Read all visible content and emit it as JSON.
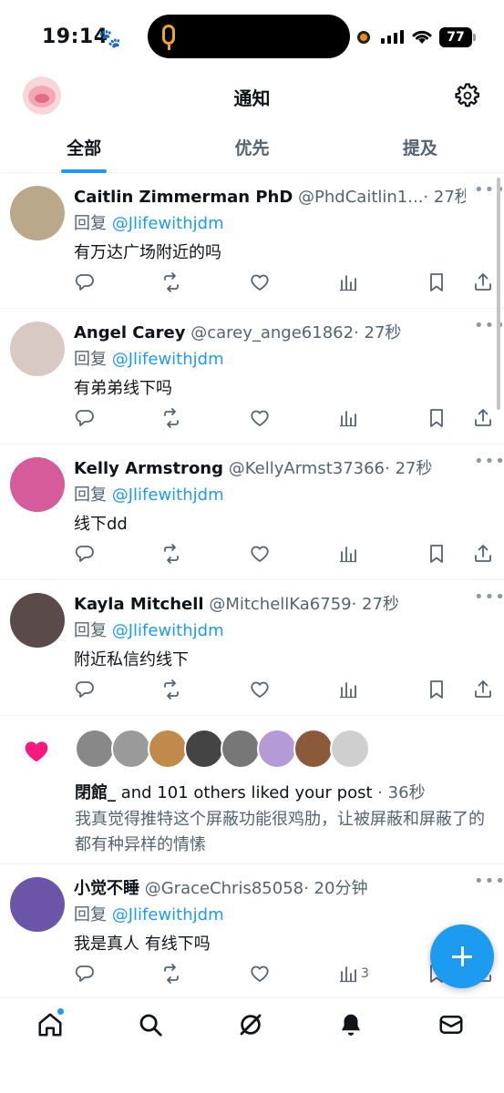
{
  "status_bar": {
    "time": "19:14",
    "battery": "77"
  },
  "header": {
    "title": "通知"
  },
  "tabs": [
    {
      "label": "全部",
      "active": true
    },
    {
      "label": "优先",
      "active": false
    },
    {
      "label": "提及",
      "active": false
    }
  ],
  "replies": [
    {
      "name": "Caitlin Zimmerman PhD",
      "handle": "@PhdCaitlin1...",
      "time": "· 27秒",
      "replying_prefix": "回复 ",
      "replying_to": "@Jlifewithjdm",
      "text": "有万达广场附近的吗",
      "avatar_color": "#b9a98a",
      "views": ""
    },
    {
      "name": "Angel Carey",
      "handle": "@carey_ange61862",
      "time": "· 27秒",
      "replying_prefix": "回复 ",
      "replying_to": "@Jlifewithjdm",
      "text": "有弟弟线下吗",
      "avatar_color": "#d8c9c2",
      "views": ""
    },
    {
      "name": "Kelly Armstrong",
      "handle": "@KellyArmst37366",
      "time": "· 27秒",
      "replying_prefix": "回复 ",
      "replying_to": "@Jlifewithjdm",
      "text": "线下dd",
      "avatar_color": "#d65b9a",
      "views": ""
    },
    {
      "name": "Kayla Mitchell",
      "handle": "@MitchellKa6759",
      "time": "· 27秒",
      "replying_prefix": "回复 ",
      "replying_to": "@Jlifewithjdm",
      "text": "附近私信约线下",
      "avatar_color": "#5a4a4a",
      "views": ""
    }
  ],
  "likes_notification": {
    "actor": "閉館_",
    "rest": " and 101 others liked your post",
    "time": " · 36秒",
    "post_text": "我真觉得推特这个屏蔽功能很鸡肋，让被屏蔽和屏蔽了的都有种异样的情愫",
    "face_colors": [
      "#888888",
      "#9a9a9a",
      "#c08a4a",
      "#444444",
      "#777777",
      "#b49ad6",
      "#8a5a3a",
      "#cfcfcf"
    ]
  },
  "last_reply": {
    "name": "小觉不睡",
    "handle": "@GraceChris85058",
    "time": "· 20分钟",
    "replying_prefix": "回复 ",
    "replying_to": "@Jlifewithjdm",
    "text": "我是真人 有线下吗",
    "avatar_color": "#6b55a8",
    "views": "3"
  },
  "icons": {
    "reply": "reply-icon",
    "retweet": "retweet-icon",
    "like": "heart-icon",
    "views": "views-icon",
    "bookmark": "bookmark-icon",
    "share": "share-icon"
  },
  "colors": {
    "accent": "#1d9bf0",
    "like_heart": "#f91880",
    "text_secondary": "#536471"
  }
}
